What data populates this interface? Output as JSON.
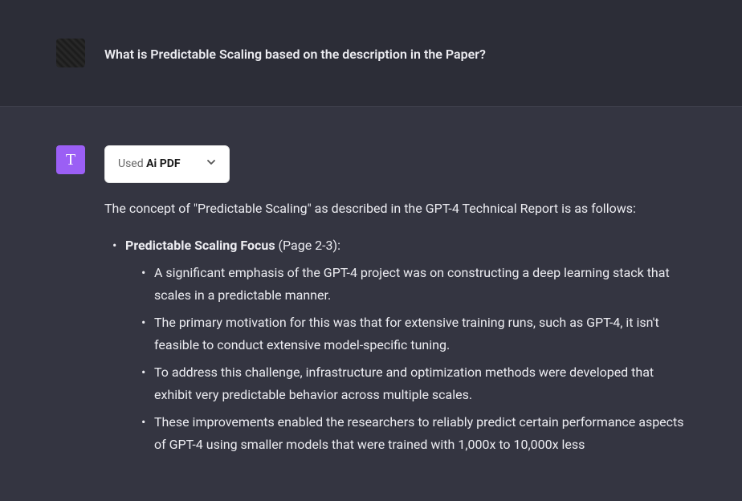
{
  "user": {
    "question": "What is Predictable Scaling based on the description in the Paper?"
  },
  "assistant": {
    "avatar_letter": "T",
    "plugin": {
      "prefix": "Used ",
      "name": "Ai PDF"
    },
    "intro": "The concept of \"Predictable Scaling\" as described in the GPT-4 Technical Report is as follows:",
    "bullets": [
      {
        "title": "Predictable Scaling Focus",
        "page_ref": " (Page 2-3):",
        "sub": [
          "A significant emphasis of the GPT-4 project was on constructing a deep learning stack that scales in a predictable manner.",
          "The primary motivation for this was that for extensive training runs, such as GPT-4, it isn't feasible to conduct extensive model-specific tuning.",
          "To address this challenge, infrastructure and optimization methods were developed that exhibit very predictable behavior across multiple scales.",
          "These improvements enabled the researchers to reliably predict certain performance aspects of GPT-4 using smaller models that were trained with 1,000x to 10,000x less"
        ]
      }
    ]
  }
}
